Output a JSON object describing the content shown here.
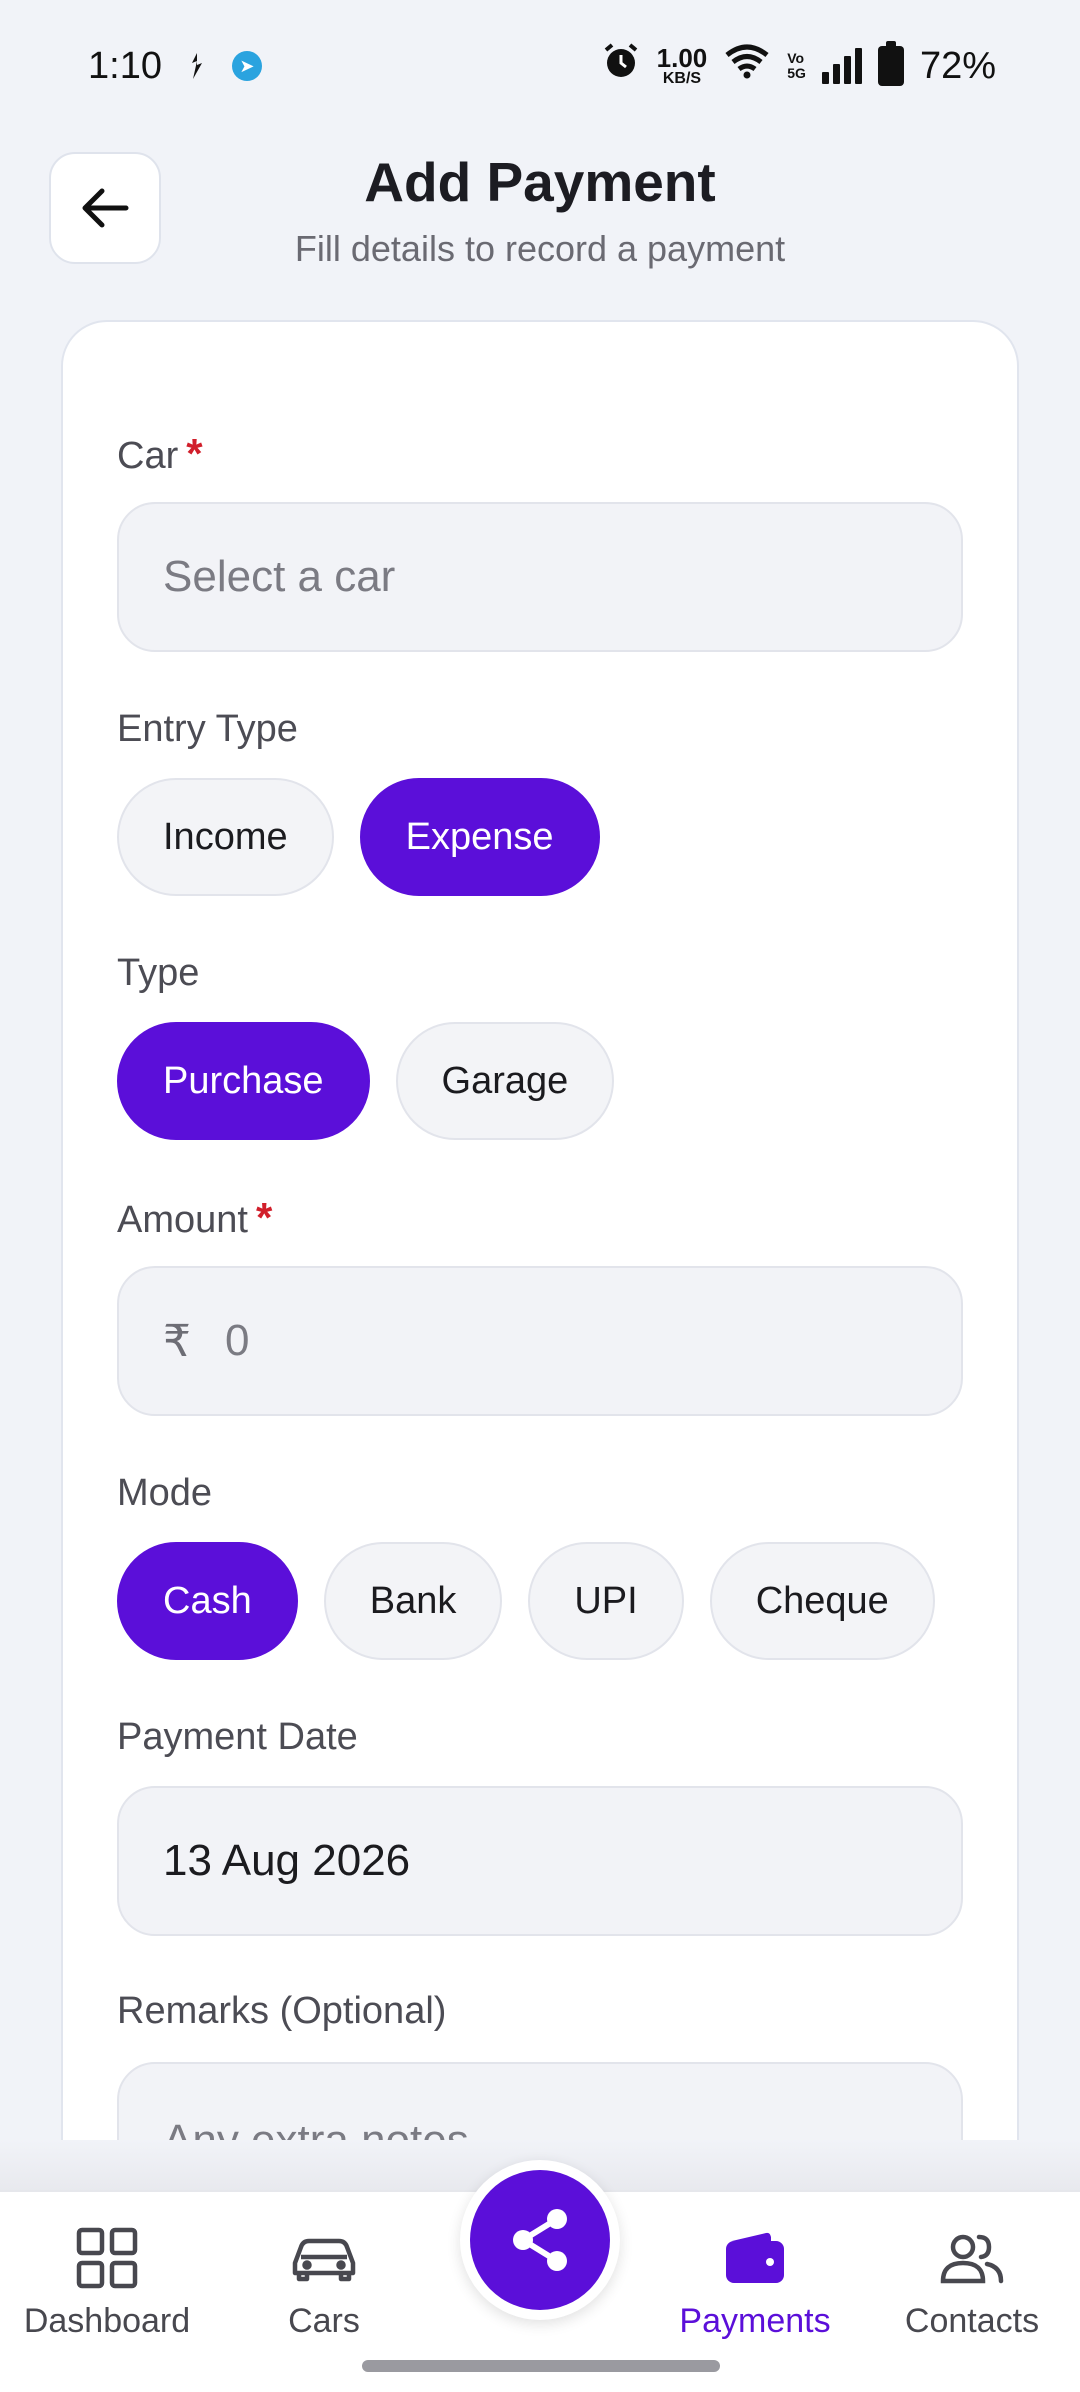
{
  "status_bar": {
    "time": "1:10",
    "net_speed": "1.00",
    "net_unit": "KB/S",
    "battery": "72%"
  },
  "header": {
    "title": "Add Payment",
    "subtitle": "Fill details to record a payment"
  },
  "form": {
    "car": {
      "label": "Car",
      "required_mark": "*",
      "placeholder": "Select a car"
    },
    "entry_type": {
      "label": "Entry Type",
      "options": [
        "Income",
        "Expense"
      ],
      "selected": "Expense"
    },
    "type": {
      "label": "Type",
      "options": [
        "Purchase",
        "Garage"
      ],
      "selected": "Purchase"
    },
    "amount": {
      "label": "Amount",
      "required_mark": "*",
      "currency": "₹",
      "placeholder": "0"
    },
    "mode": {
      "label": "Mode",
      "options": [
        "Cash",
        "Bank",
        "UPI",
        "Cheque"
      ],
      "selected": "Cash"
    },
    "payment_date": {
      "label": "Payment Date",
      "value": "13 Aug 2026"
    },
    "remarks": {
      "label": "Remarks (Optional)",
      "placeholder": "Any extra notes"
    }
  },
  "bottom_nav": {
    "items": [
      "Dashboard",
      "Cars",
      "Payments",
      "Contacts"
    ],
    "active": "Payments"
  },
  "colors": {
    "accent": "#5b0fd9",
    "required": "#d11f2b",
    "background": "#f1f3f8"
  }
}
